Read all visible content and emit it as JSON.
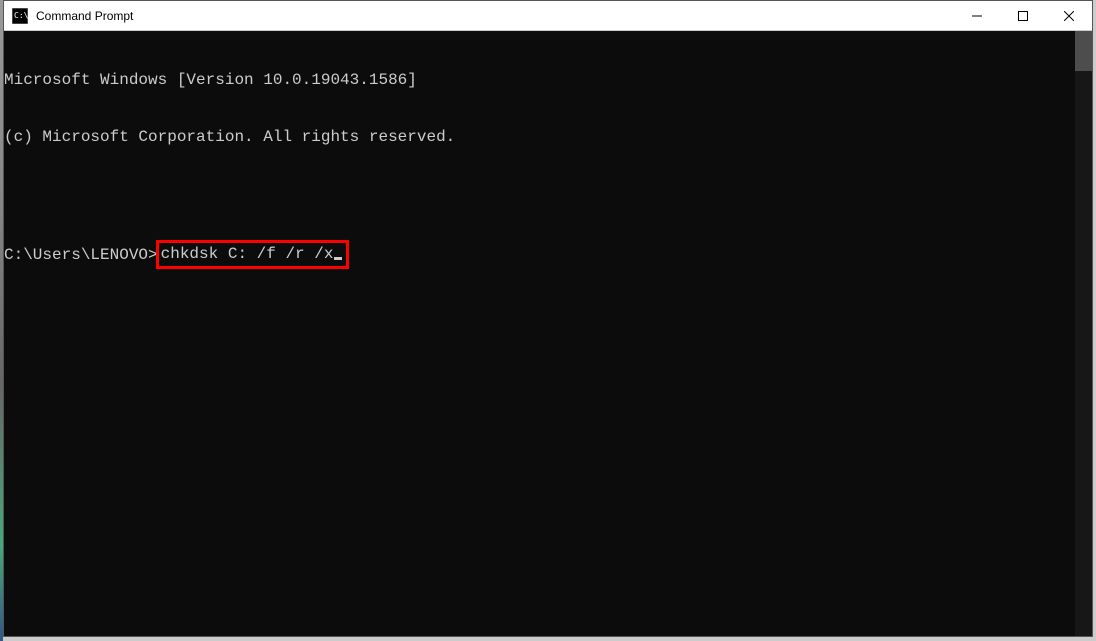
{
  "window": {
    "title": "Command Prompt"
  },
  "terminal": {
    "line1": "Microsoft Windows [Version 10.0.19043.1586]",
    "line2": "(c) Microsoft Corporation. All rights reserved.",
    "prompt": "C:\\Users\\LENOVO>",
    "command": "chkdsk C: /f /r /x"
  }
}
